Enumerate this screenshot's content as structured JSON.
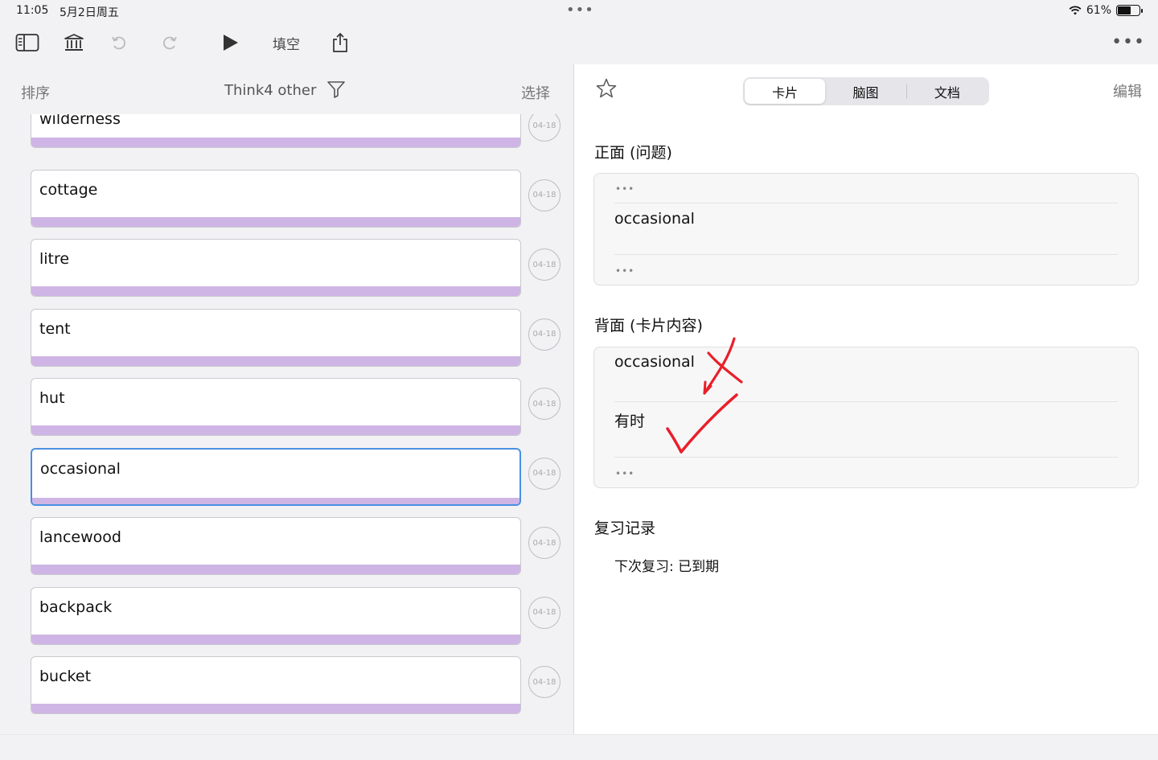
{
  "status": {
    "time": "11:05",
    "date": "5月2日周五",
    "battery": "61%"
  },
  "toolbar": {
    "fill_blank_label": "填空"
  },
  "list": {
    "sort_label": "排序",
    "title": "Think4 other",
    "select_label": "选择",
    "items": [
      {
        "word": "wilderness",
        "date": "04-18"
      },
      {
        "word": "cottage",
        "date": "04-18"
      },
      {
        "word": "litre",
        "date": "04-18"
      },
      {
        "word": "tent",
        "date": "04-18"
      },
      {
        "word": "hut",
        "date": "04-18"
      },
      {
        "word": "occasional",
        "date": "04-18",
        "selected": true
      },
      {
        "word": "lancewood",
        "date": "04-18"
      },
      {
        "word": "backpack",
        "date": "04-18"
      },
      {
        "word": "bucket",
        "date": "04-18"
      }
    ]
  },
  "detail": {
    "tabs": [
      "卡片",
      "脑图",
      "文档"
    ],
    "active_tab": "卡片",
    "edit_label": "编辑",
    "front_title": "正面 (问题)",
    "front_text": "occasional",
    "back_title": "背面 (卡片内容)",
    "back_word": "occasional",
    "back_meaning": "有时",
    "review_title": "复习记录",
    "next_review": "下次复习: 已到期"
  },
  "colors": {
    "band": "#cfb5e5",
    "selected_border": "#4a90e2",
    "annotation": "#e8202a"
  }
}
